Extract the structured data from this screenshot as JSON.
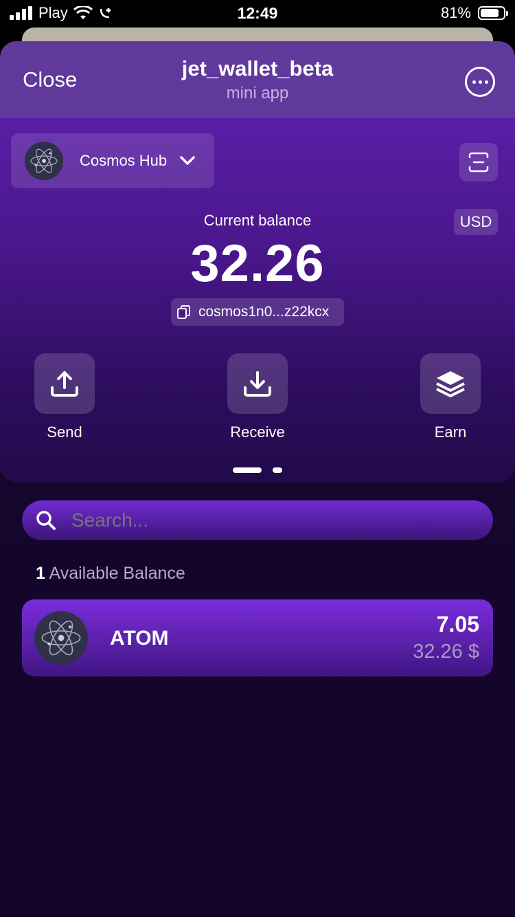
{
  "status_bar": {
    "carrier": "Play",
    "time": "12:49",
    "battery": "81%",
    "battery_level": 0.81
  },
  "header": {
    "close_label": "Close",
    "title": "jet_wallet_beta",
    "subtitle": "mini app"
  },
  "network": {
    "name": "Cosmos Hub"
  },
  "balance": {
    "label": "Current balance",
    "value": "32.26",
    "currency": "USD",
    "address": "cosmos1n0...z22kcx"
  },
  "actions": {
    "send": "Send",
    "receive": "Receive",
    "earn": "Earn"
  },
  "pager": {
    "pages": 2,
    "active": 0
  },
  "search": {
    "placeholder": "Search..."
  },
  "assets": {
    "count": "1",
    "label": "Available Balance",
    "items": [
      {
        "symbol": "ATOM",
        "amount": "7.05",
        "usd": "32.26 $"
      }
    ]
  },
  "colors": {
    "accent": "#7a2cdb",
    "header": "#5f3a9c",
    "background": "#14042a"
  }
}
